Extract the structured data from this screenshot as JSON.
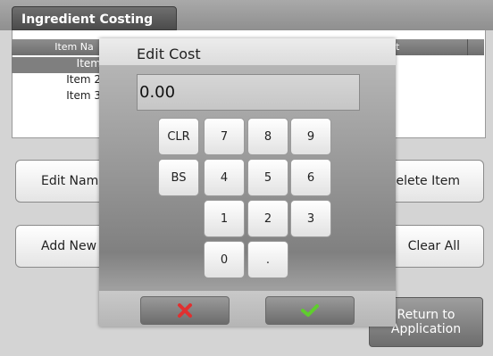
{
  "app": {
    "tab_title": "Ingredient Costing"
  },
  "list": {
    "headers": [
      "Item Na",
      "t"
    ],
    "rows": [
      "Item",
      "Item 2",
      "Item 3"
    ]
  },
  "buttons": {
    "edit_name": "Edit Name",
    "add_new": "Add New",
    "delete_item": "Delete Item",
    "clear_all": "Clear All",
    "return_line1": "Return to",
    "return_line2": "Application"
  },
  "dialog": {
    "title": "Edit Cost",
    "value": "0.00",
    "keys": [
      "CLR",
      "7",
      "8",
      "9",
      "BS",
      "4",
      "5",
      "6",
      "1",
      "2",
      "3",
      "0",
      "."
    ],
    "cancel_icon": "x-icon",
    "ok_icon": "check-icon",
    "colors": {
      "cancel": "#e03030",
      "ok": "#5fce2d"
    }
  }
}
